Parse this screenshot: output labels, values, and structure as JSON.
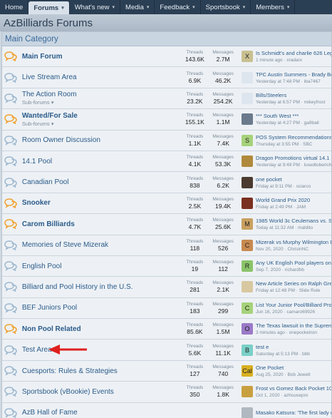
{
  "nav": {
    "items": [
      {
        "label": "Home",
        "caret": false,
        "active": false
      },
      {
        "label": "Forums",
        "caret": true,
        "active": true
      },
      {
        "label": "What's new",
        "caret": true,
        "active": false
      },
      {
        "label": "Media",
        "caret": true,
        "active": false
      },
      {
        "label": "Feedback",
        "caret": true,
        "active": false
      },
      {
        "label": "Sportsbook",
        "caret": true,
        "active": false
      },
      {
        "label": "Members",
        "caret": true,
        "active": false
      }
    ]
  },
  "page": {
    "title": "AzBilliards Forums"
  },
  "category": {
    "title": "Main Category"
  },
  "labels": {
    "threads": "Threads",
    "messages": "Messages"
  },
  "colors": {
    "read_icon": "#9db7cf",
    "unread_icon": "#f0a030",
    "arrow": "#e0201e"
  },
  "forums": [
    {
      "name": "Main Forum",
      "bold": true,
      "unread": true,
      "subforums": "",
      "threads": "143.6K",
      "messages": "2.7M",
      "latest_title": "Is Schmidt's and charlie 626 Legit",
      "latest_meta": "1 minute ago · xradarx",
      "avatar_letter": "X",
      "avatar_color": "#c8c090"
    },
    {
      "name": "Live Stream Area",
      "bold": false,
      "unread": false,
      "subforums": "",
      "threads": "6.9K",
      "messages": "46.2K",
      "latest_title": "TPC Austin Summers - Brady Behr...",
      "latest_meta": "Yesterday at 7:48 PM · iba7467",
      "avatar_letter": "",
      "avatar_color": "#dde6ee"
    },
    {
      "name": "The Action Room",
      "bold": false,
      "unread": false,
      "subforums": "Sub-forums",
      "threads": "23.2K",
      "messages": "254.2K",
      "latest_title": "Bills/Steelers",
      "latest_meta": "Yesterday at 6:57 PM · mikeyfrost",
      "avatar_letter": "",
      "avatar_color": "#dde6ee"
    },
    {
      "name": "Wanted/For Sale",
      "bold": true,
      "unread": true,
      "subforums": "Sub-forums",
      "threads": "155.1K",
      "messages": "1.1M",
      "latest_title": "*** South West ***",
      "latest_meta": "Yesterday at 4:27 PM · ga9ball",
      "avatar_letter": "",
      "avatar_color": "#6a7a8c"
    },
    {
      "name": "Room Owner Discussion",
      "bold": false,
      "unread": false,
      "subforums": "",
      "threads": "1.1K",
      "messages": "7.4K",
      "latest_title": "POS System Recommendations",
      "latest_meta": "Thursday at 3:55 PM · SBC",
      "avatar_letter": "S",
      "avatar_color": "#a6d27a"
    },
    {
      "name": "14.1 Pool",
      "bold": false,
      "unread": false,
      "subforums": "",
      "threads": "4.1K",
      "messages": "53.3K",
      "latest_title": "Dragon Promotions virtual 14.1",
      "latest_meta": "Yesterday at 9:49 PM · lusedtoberich",
      "avatar_letter": "",
      "avatar_color": "#b08a3c"
    },
    {
      "name": "Canadian Pool",
      "bold": false,
      "unread": false,
      "subforums": "",
      "threads": "838",
      "messages": "6.2K",
      "latest_title": "one pocket",
      "latest_meta": "Friday at 9:11 PM · sciarco",
      "avatar_letter": "",
      "avatar_color": "#4a3a30"
    },
    {
      "name": "Snooker",
      "bold": true,
      "unread": true,
      "subforums": "",
      "threads": "2.5K",
      "messages": "19.4K",
      "latest_title": "World Grand Prix 2020",
      "latest_meta": "Friday at 2:49 PM · JAM",
      "avatar_letter": "",
      "avatar_color": "#7a3020"
    },
    {
      "name": "Carom Billiards",
      "bold": true,
      "unread": true,
      "subforums": "",
      "threads": "4.7K",
      "messages": "25.6K",
      "latest_title": "1985 World 3c Ceulemans vs. Scherper",
      "latest_meta": "Today at 11:32 AM · maldito",
      "avatar_letter": "M",
      "avatar_color": "#c8a060"
    },
    {
      "name": "Memories of Steve Mizerak",
      "bold": false,
      "unread": false,
      "subforums": "",
      "threads": "118",
      "messages": "526",
      "latest_title": "Mizerak vs Murphy Wilmington DE",
      "latest_meta": "Nov 20, 2020 · ChrisinNC",
      "avatar_letter": "C",
      "avatar_color": "#c88a50"
    },
    {
      "name": "English Pool",
      "bold": false,
      "unread": false,
      "subforums": "",
      "threads": "19",
      "messages": "112",
      "latest_title": "Any UK English Pool players on here?",
      "latest_meta": "Sep 7, 2020 · richardhb",
      "avatar_letter": "R",
      "avatar_color": "#8ac46a"
    },
    {
      "name": "Billiard and Pool History in the U.S.",
      "bold": false,
      "unread": false,
      "subforums": "",
      "threads": "281",
      "messages": "2.1K",
      "latest_title": "New Article Series on Ralph Greenl...",
      "latest_meta": "Friday at 12:48 PM · Slide Rule",
      "avatar_letter": "",
      "avatar_color": "#d8c8a0"
    },
    {
      "name": "BEF Juniors Pool",
      "bold": false,
      "unread": false,
      "subforums": "",
      "threads": "183",
      "messages": "299",
      "latest_title": "List Your Junior Pool/Billiard Program",
      "latest_meta": "Jun 16, 2020 · camaro69926",
      "avatar_letter": "C",
      "avatar_color": "#a6d27a"
    },
    {
      "name": "Non Pool Related",
      "bold": true,
      "unread": true,
      "subforums": "",
      "threads": "85.6K",
      "messages": "1.5M",
      "latest_title": "The Texas lawsuit in the Supreme C...",
      "latest_meta": "3 minutes ago · onepocketron",
      "avatar_letter": "O",
      "avatar_color": "#9a7ac8"
    },
    {
      "name": "Test Area",
      "bold": false,
      "unread": false,
      "subforums": "",
      "threads": "5.6K",
      "messages": "11.1K",
      "latest_title": "test e",
      "latest_meta": "Saturday at 5:13 PM · bbb",
      "avatar_letter": "B",
      "avatar_color": "#7ad0c8"
    },
    {
      "name": "Cuesports: Rules & Strategies",
      "bold": false,
      "unread": false,
      "subforums": "",
      "threads": "127",
      "messages": "740",
      "latest_title": "One Pocket",
      "latest_meta": "Aug 25, 2020 · Bob Jewett",
      "avatar_letter": "Cal",
      "avatar_color": "#d8b020"
    },
    {
      "name": "Sportsbook (vBookie) Events",
      "bold": false,
      "unread": false,
      "subforums": "",
      "threads": "350",
      "messages": "1.8K",
      "latest_title": "Frost vs Gomez Back Pocket 10-Ball",
      "latest_meta": "Oct 1, 2020 · azhousepro",
      "avatar_letter": "",
      "avatar_color": "#c8a040"
    },
    {
      "name": "AzB Hall of Fame",
      "bold": false,
      "unread": false,
      "subforums": "",
      "threads": "",
      "messages": "",
      "latest_title": "Masako Katsura: 'The first lady of b...",
      "latest_meta": "",
      "avatar_letter": "",
      "avatar_color": "#b0b8c0"
    }
  ]
}
